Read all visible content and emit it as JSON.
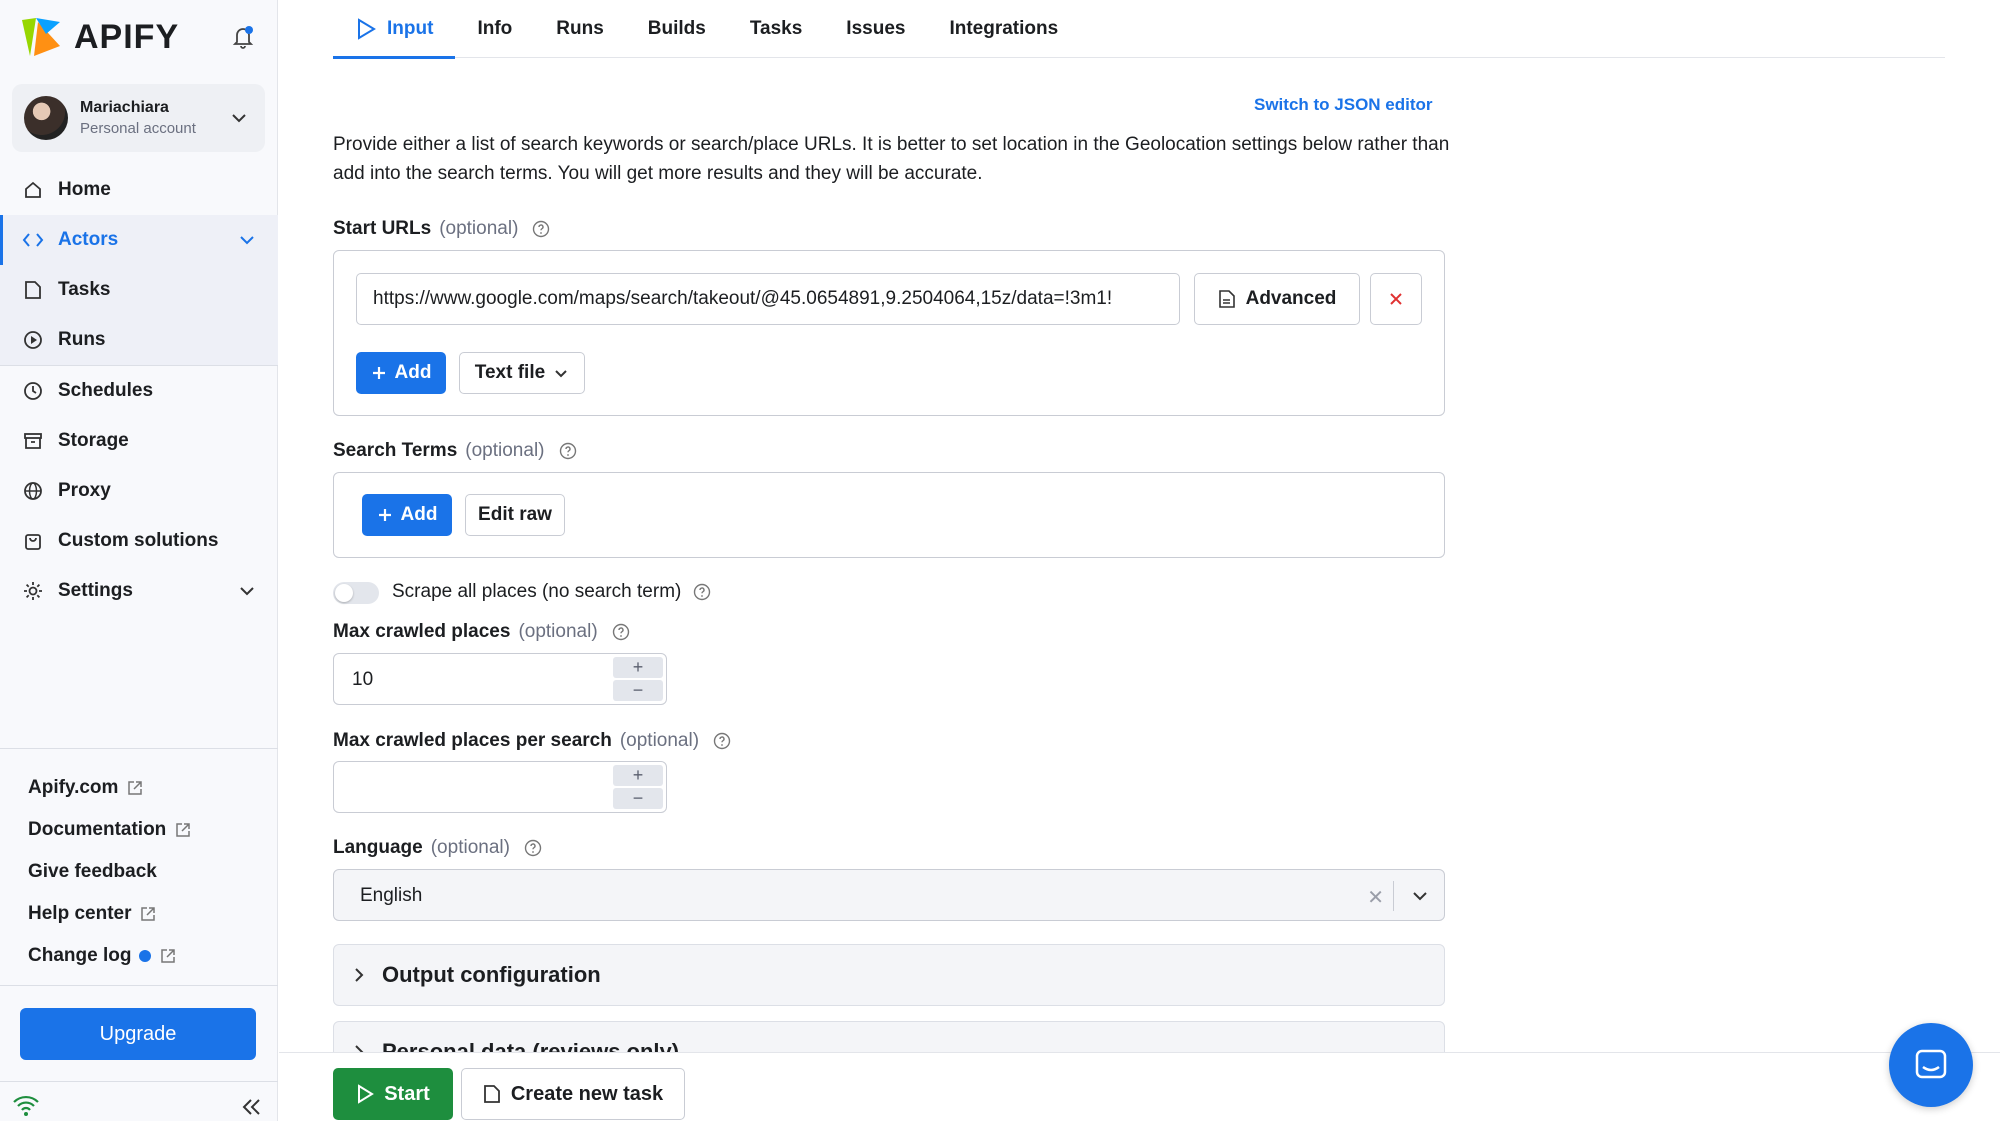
{
  "brand": {
    "name": "APIFY"
  },
  "account": {
    "name": "Mariachiara",
    "type": "Personal account"
  },
  "nav": {
    "home": "Home",
    "actors": "Actors",
    "tasks": "Tasks",
    "runs": "Runs",
    "schedules": "Schedules",
    "storage": "Storage",
    "proxy": "Proxy",
    "custom": "Custom solutions",
    "settings": "Settings"
  },
  "footer": {
    "apify": "Apify.com",
    "docs": "Documentation",
    "feedback": "Give feedback",
    "help": "Help center",
    "changelog": "Change log",
    "upgrade": "Upgrade"
  },
  "tabs": [
    "Input",
    "Info",
    "Runs",
    "Builds",
    "Tasks",
    "Issues",
    "Integrations"
  ],
  "json_link": "Switch to JSON editor",
  "description": "Provide either a list of search keywords or search/place URLs. It is better to set location in the Geolocation settings below rather than add into the search terms. You will get more results and they will be accurate.",
  "start_urls": {
    "label": "Start URLs",
    "optional": "(optional)",
    "value": "https://www.google.com/maps/search/takeout/@45.0654891,9.2504064,15z/data=!3m1!",
    "advanced": "Advanced",
    "add": "Add",
    "text_file": "Text file"
  },
  "search_terms": {
    "label": "Search Terms",
    "optional": "(optional)",
    "add": "Add",
    "edit_raw": "Edit raw"
  },
  "scrape_all": {
    "label": "Scrape all places (no search term)",
    "enabled": false
  },
  "max_places": {
    "label": "Max crawled places",
    "optional": "(optional)",
    "value": "10"
  },
  "max_per_search": {
    "label": "Max crawled places per search",
    "optional": "(optional)",
    "value": ""
  },
  "language": {
    "label": "Language",
    "optional": "(optional)",
    "value": "English"
  },
  "sections": [
    "Output configuration",
    "Personal data (reviews only)"
  ],
  "actions": {
    "start": "Start",
    "create_task": "Create new task"
  },
  "colors": {
    "accent": "#1a73e8",
    "start": "#1e8e3e",
    "danger": "#e03131"
  }
}
